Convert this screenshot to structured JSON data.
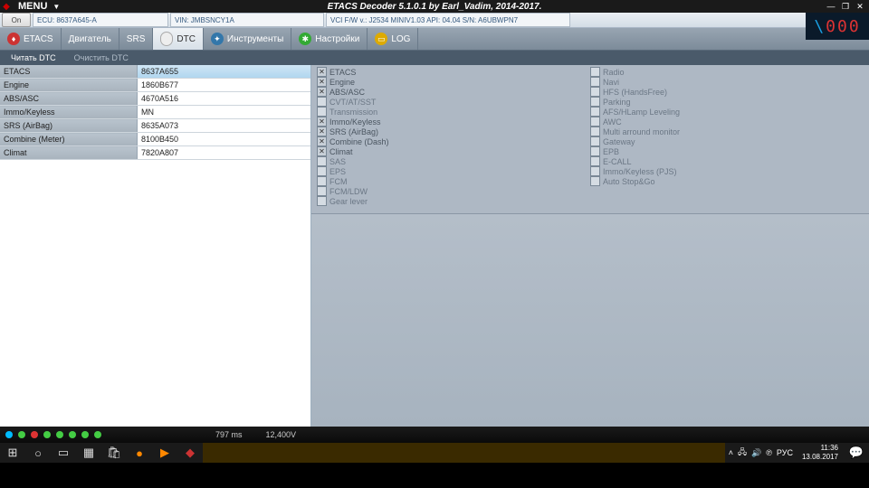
{
  "titlebar": {
    "menu": "MENU",
    "title": "ETACS Decoder 5.1.0.1 by Earl_Vadim, 2014-2017."
  },
  "infobar": {
    "on": "On",
    "ecu": "ECU: 8637A645-A",
    "vin": "VIN: JMBSNCY1A",
    "vci": "VCI F/W v.: J2534 MINIV1.03 API: 04.04 S/N: A6UBWPN7"
  },
  "tabs": [
    {
      "label": "ETACS"
    },
    {
      "label": "Двигатель"
    },
    {
      "label": "SRS"
    },
    {
      "label": "DTC",
      "active": true
    },
    {
      "label": "Инструменты"
    },
    {
      "label": "Настройки"
    },
    {
      "label": "LOG"
    }
  ],
  "subtabs": {
    "read": "Читать DTC",
    "clear": "Очистить DTC"
  },
  "grid": [
    {
      "k": "ETACS",
      "v": "8637A655",
      "sel": true
    },
    {
      "k": "Engine",
      "v": "1860B677"
    },
    {
      "k": "ABS/ASC",
      "v": "4670A516"
    },
    {
      "k": "Immo/Keyless",
      "v": "MN"
    },
    {
      "k": "SRS (AirBag)",
      "v": "8635A073"
    },
    {
      "k": "Combine (Meter)",
      "v": "8100B450"
    },
    {
      "k": "Climat",
      "v": "7820A807"
    }
  ],
  "checks": {
    "col1": [
      {
        "label": "ETACS",
        "on": true
      },
      {
        "label": "Engine",
        "on": true
      },
      {
        "label": "ABS/ASC",
        "on": true
      },
      {
        "label": "CVT/AT/SST",
        "on": false
      },
      {
        "label": "Transmission",
        "on": false
      },
      {
        "label": "Immo/Keyless",
        "on": true
      },
      {
        "label": "SRS (AirBag)",
        "on": true
      },
      {
        "label": "Combine (Dash)",
        "on": true
      },
      {
        "label": "Climat",
        "on": true
      },
      {
        "label": "SAS",
        "on": false
      },
      {
        "label": "EPS",
        "on": false
      },
      {
        "label": "FCM",
        "on": false
      },
      {
        "label": "FCM/LDW",
        "on": false
      },
      {
        "label": "Gear lever",
        "on": false
      }
    ],
    "col2": [
      {
        "label": "Radio",
        "on": false
      },
      {
        "label": "Navi",
        "on": false
      },
      {
        "label": "HFS (HandsFree)",
        "on": false
      },
      {
        "label": "Parking",
        "on": false
      },
      {
        "label": "AFS/HLamp Leveling",
        "on": false
      },
      {
        "label": "AWC",
        "on": false
      },
      {
        "label": "Multi arround monitor",
        "on": false
      },
      {
        "label": "Gateway",
        "on": false
      },
      {
        "label": "EPB",
        "on": false
      },
      {
        "label": "E-CALL",
        "on": false
      },
      {
        "label": "Immo/Keyless (PJS)",
        "on": false
      },
      {
        "label": "Auto Stop&Go",
        "on": false
      }
    ]
  },
  "status": {
    "ms": "797 ms",
    "volt": "12,400V"
  },
  "tray": {
    "lang": "РУС",
    "time": "11:36",
    "date": "13.08.2017",
    "sym": "℗"
  }
}
